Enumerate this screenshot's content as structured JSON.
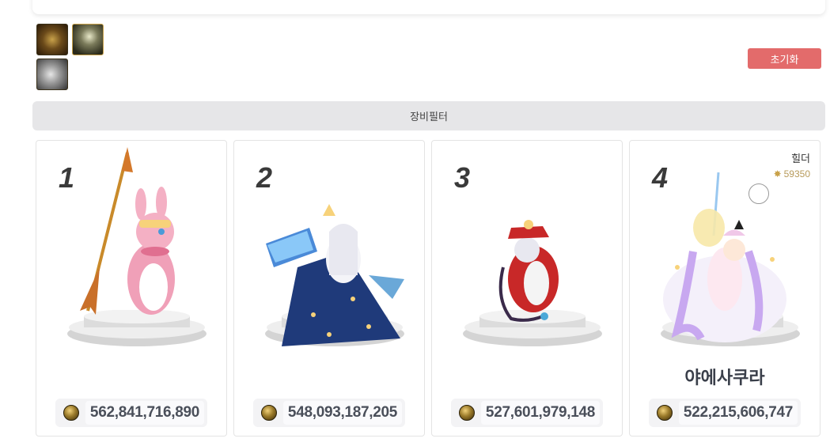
{
  "equip_filter": {
    "icons": [
      "weapon-icon",
      "orb-icon",
      "armor-icon"
    ],
    "reset_label": "초기화",
    "filter_label": "장비필터"
  },
  "cards": [
    {
      "rank": "1",
      "score": "562,841,716,890",
      "name": "",
      "guild": "",
      "guild_score": ""
    },
    {
      "rank": "2",
      "score": "548,093,187,205",
      "name": "",
      "guild": "",
      "guild_score": ""
    },
    {
      "rank": "3",
      "score": "527,601,979,148",
      "name": "",
      "guild": "",
      "guild_score": ""
    },
    {
      "rank": "4",
      "score": "522,215,606,747",
      "name": "야에사쿠라",
      "guild": "힐더",
      "guild_score": "59350"
    }
  ],
  "colors": {
    "reset_button": "#e36b6b",
    "filter_bar": "#e6e6e8",
    "score_text": "#4a4f5a"
  }
}
